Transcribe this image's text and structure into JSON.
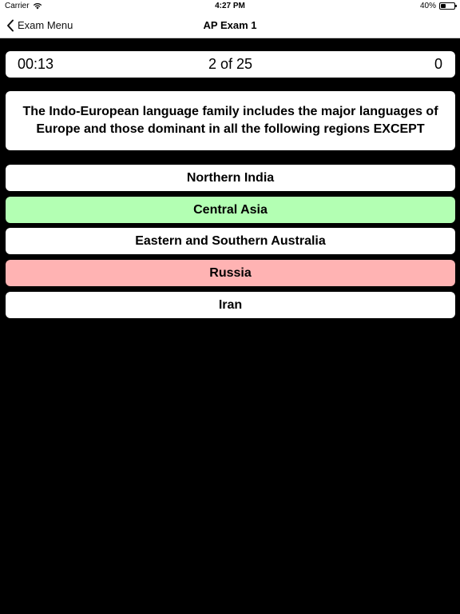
{
  "status_bar": {
    "carrier": "Carrier",
    "time": "4:27 PM",
    "battery": "40%",
    "battery_level": 0.4
  },
  "nav": {
    "back_label": "Exam Menu",
    "title": "AP Exam 1"
  },
  "info": {
    "timer": "00:13",
    "progress": "2 of 25",
    "score": "0"
  },
  "question": "The Indo-European language family includes the major languages of Europe and those dominant in all the following regions EXCEPT",
  "answers": [
    {
      "label": "Northern India",
      "state": "neutral",
      "color": "#ffffff"
    },
    {
      "label": "Central Asia",
      "state": "correct",
      "color": "#b3ffb3"
    },
    {
      "label": "Eastern and Southern Australia",
      "state": "neutral",
      "color": "#ffffff"
    },
    {
      "label": "Russia",
      "state": "incorrect",
      "color": "#ffb3b3"
    },
    {
      "label": "Iran",
      "state": "neutral",
      "color": "#ffffff"
    }
  ],
  "icons": {
    "wifi": "wifi-icon",
    "battery": "battery-icon",
    "back": "chevron-left-icon"
  }
}
